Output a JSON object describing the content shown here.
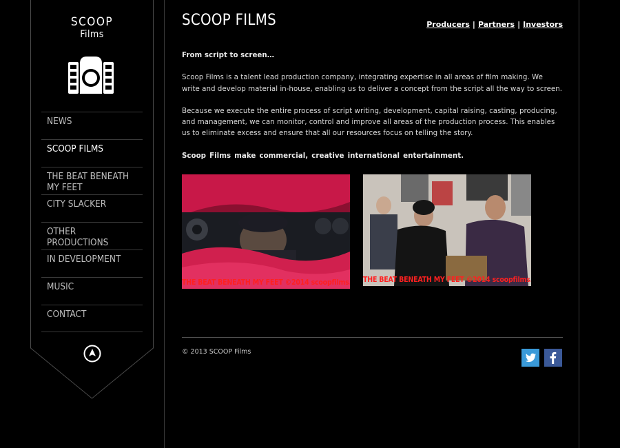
{
  "logo": {
    "line1": "SCOOP",
    "line2": "Films"
  },
  "nav": {
    "items": [
      {
        "label": "NEWS"
      },
      {
        "label": "SCOOP FILMS"
      },
      {
        "label": "THE BEAT BENEATH MY FEET"
      },
      {
        "label": "CITY SLACKER"
      },
      {
        "label": "OTHER PRODUCTIONS"
      },
      {
        "label": "IN DEVELOPMENT"
      },
      {
        "label": "MUSIC"
      },
      {
        "label": "CONTACT"
      }
    ],
    "active": "SCOOP FILMS"
  },
  "header": {
    "title": "SCOOP FILMS",
    "links": [
      "Producers",
      "Partners",
      "Investors"
    ],
    "separator": "|"
  },
  "content": {
    "intro": "From script to screen…",
    "para1": "Scoop Films is a talent lead production company, integrating expertise in all areas of film making. We write and develop material in-house, enabling us to deliver a concept from the script all the way to screen.",
    "para2": "Because we execute the entire process of script writing, development, capital raising, casting, producing, and management, we can monitor, control and improve all areas of the production process. This enables us to eliminate excess and ensure that all our resources focus on telling the story.",
    "tagline": "Scoop Films make  commercial, creative  international  entertainment."
  },
  "photos": [
    {
      "caption": "THE BEAT BENEATH MY FEET ©2014 scoopfilms.com"
    },
    {
      "caption": "THE BEAT BENEATH MY FEET ©2014 scoopfilms.com"
    }
  ],
  "footer": {
    "copyright": "© 2013 SCOOP Films"
  },
  "colors": {
    "background": "#000000",
    "caption": "#ff2020",
    "twitter": "#3a9ad9",
    "facebook": "#3b5998"
  }
}
